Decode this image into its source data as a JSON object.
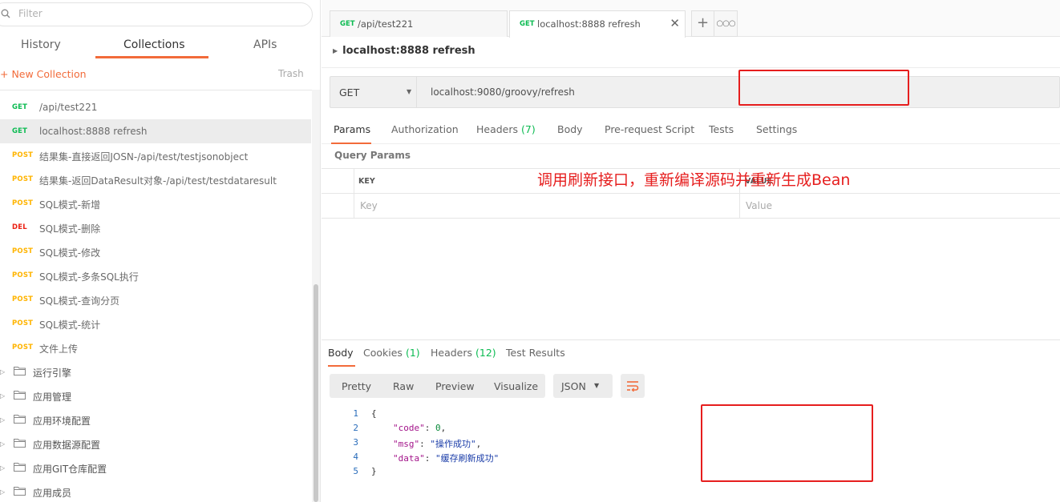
{
  "sidebar": {
    "filter_placeholder": "Filter",
    "tabs": [
      {
        "label": "History"
      },
      {
        "label": "Collections"
      },
      {
        "label": "APIs"
      }
    ],
    "new_collection": "+ New Collection",
    "trash": "Trash",
    "requests": [
      {
        "method": "GET",
        "name": "/api/test221"
      },
      {
        "method": "GET",
        "name": "localhost:8888 refresh"
      },
      {
        "method": "POST",
        "name": "结果集-直接返回JOSN-/api/test/testjsonobject"
      },
      {
        "method": "POST",
        "name": "结果集-返回DataResult对象-/api/test/testdataresult"
      },
      {
        "method": "POST",
        "name": "SQL模式-新增"
      },
      {
        "method": "DEL",
        "name": "SQL模式-删除"
      },
      {
        "method": "POST",
        "name": "SQL模式-修改"
      },
      {
        "method": "POST",
        "name": "SQL模式-多条SQL执行"
      },
      {
        "method": "POST",
        "name": "SQL模式-查询分页"
      },
      {
        "method": "POST",
        "name": "SQL模式-统计"
      },
      {
        "method": "POST",
        "name": "文件上传"
      }
    ],
    "folders": [
      {
        "name": "运行引擎"
      },
      {
        "name": "应用管理"
      },
      {
        "name": "应用环境配置"
      },
      {
        "name": "应用数据源配置"
      },
      {
        "name": "应用GIT仓库配置"
      },
      {
        "name": "应用成员"
      }
    ]
  },
  "request_tabs": [
    {
      "method": "GET",
      "name": "/api/test221"
    },
    {
      "method": "GET",
      "name": "localhost:8888 refresh"
    }
  ],
  "request": {
    "title": "localhost:8888 refresh",
    "method": "GET",
    "url": "localhost:9080/groovy/refresh"
  },
  "request_subtabs": {
    "params": "Params",
    "authorization": "Authorization",
    "headers": "Headers",
    "headers_count": "(7)",
    "body": "Body",
    "prerequest": "Pre-request Script",
    "tests": "Tests",
    "settings": "Settings"
  },
  "query_params": {
    "label": "Query Params",
    "key_header": "KEY",
    "value_header": "VALUE",
    "key_placeholder": "Key",
    "value_placeholder": "Value"
  },
  "annotation": "调用刷新接口，重新编译源码并重新生成Bean",
  "response_tabs": {
    "body": "Body",
    "cookies": "Cookies",
    "cookies_count": "(1)",
    "headers": "Headers",
    "headers_count": "(12)",
    "test_results": "Test Results"
  },
  "view_modes": {
    "pretty": "Pretty",
    "raw": "Raw",
    "preview": "Preview",
    "visualize": "Visualize",
    "format": "JSON"
  },
  "response_body": {
    "line_numbers": [
      "1",
      "2",
      "3",
      "4",
      "5"
    ],
    "code_key": "\"code\"",
    "code_value": "0",
    "msg_key": "\"msg\"",
    "msg_value": "\"操作成功\"",
    "data_key": "\"data\"",
    "data_value": "\"缓存刷新成功\""
  },
  "colors": {
    "accent": "#f26b3a",
    "get": "#0cbb52",
    "post": "#ffb400",
    "delete": "#eb2013",
    "annotation": "#e61e1e"
  }
}
